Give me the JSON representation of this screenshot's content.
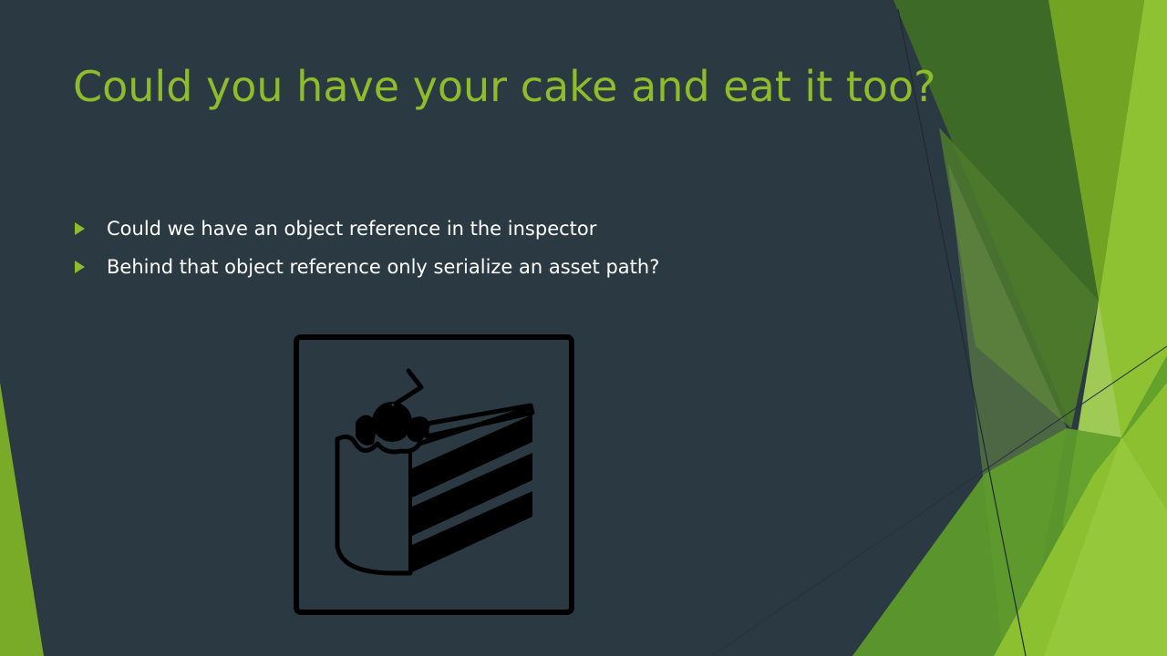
{
  "slide": {
    "title": "Could you have your cake and eat it too?",
    "bullets": [
      "Could we have an object reference in the inspector",
      "Behind that object reference only serialize an asset path?"
    ],
    "image": {
      "icon": "cake-slice-icon"
    }
  },
  "colors": {
    "background": "#2b3a42",
    "accent": "#8fbc2a",
    "text": "#ffffff"
  }
}
